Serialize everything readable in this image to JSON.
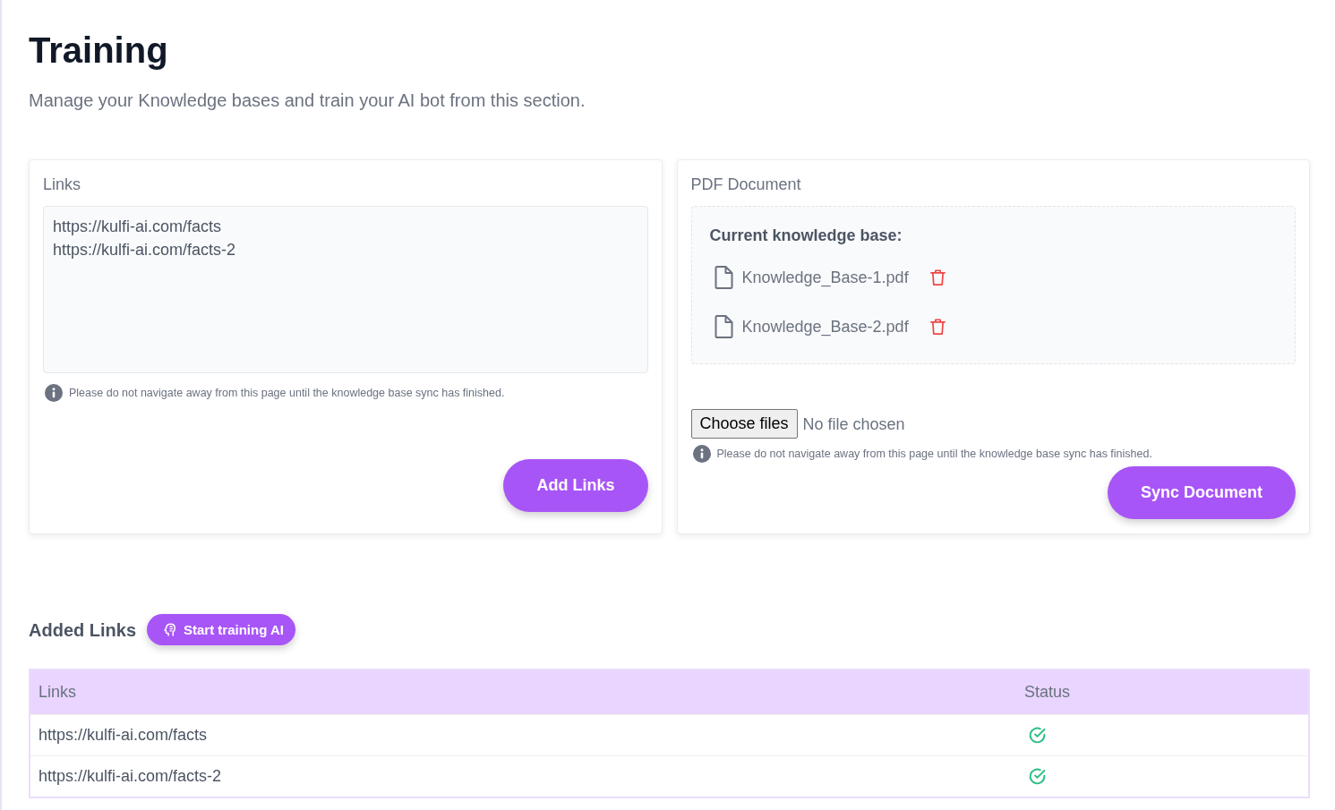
{
  "page": {
    "title": "Training",
    "subtitle": "Manage your Knowledge bases and train your AI bot from this section."
  },
  "links_card": {
    "label": "Links",
    "links": [
      "https://kulfi-ai.com/facts",
      "https://kulfi-ai.com/facts-2"
    ],
    "note": "Please do not navigate away from this page until the knowledge base sync has finished.",
    "button": "Add Links"
  },
  "pdf_card": {
    "label": "PDF Document",
    "knowledge_base": {
      "heading": "Current knowledge base:",
      "files": [
        {
          "name": "Knowledge_Base-1.pdf"
        },
        {
          "name": "Knowledge_Base-2.pdf"
        }
      ]
    },
    "file_input": {
      "button": "Choose files",
      "status": "No file chosen"
    },
    "note": "Please do not navigate away from this page until the knowledge base sync has finished.",
    "button": "Sync Document"
  },
  "added_links": {
    "title": "Added Links",
    "train_button": "Start training AI",
    "table": {
      "columns": [
        "Links",
        "Status"
      ],
      "rows": [
        {
          "link": "https://kulfi-ai.com/facts",
          "synced": true
        },
        {
          "link": "https://kulfi-ai.com/facts-2",
          "synced": true
        }
      ]
    }
  }
}
